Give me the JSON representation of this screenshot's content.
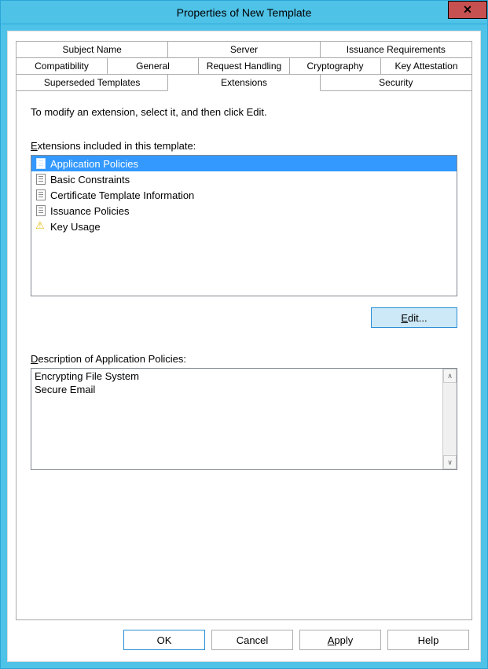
{
  "window": {
    "title": "Properties of New Template"
  },
  "tabs": {
    "row1": [
      "Subject Name",
      "Server",
      "Issuance Requirements"
    ],
    "row2": [
      "Compatibility",
      "General",
      "Request Handling",
      "Cryptography",
      "Key Attestation"
    ],
    "row3": [
      "Superseded Templates",
      "Extensions",
      "Security"
    ],
    "active": "Extensions"
  },
  "content": {
    "instruction": "To modify an extension, select it, and then click Edit.",
    "extensions_label": "Extensions included in this template:",
    "extensions": [
      {
        "name": "Application Policies",
        "icon": "doc-icon",
        "selected": true
      },
      {
        "name": "Basic Constraints",
        "icon": "doc-icon",
        "selected": false
      },
      {
        "name": "Certificate Template Information",
        "icon": "doc-icon",
        "selected": false
      },
      {
        "name": "Issuance Policies",
        "icon": "doc-icon",
        "selected": false
      },
      {
        "name": "Key Usage",
        "icon": "warn-icon",
        "selected": false
      }
    ],
    "edit_label": "Edit...",
    "description_label": "Description of Application Policies:",
    "description_lines": [
      "Encrypting File System",
      "Secure Email"
    ]
  },
  "buttons": {
    "ok": "OK",
    "cancel": "Cancel",
    "apply": "Apply",
    "help": "Help"
  }
}
